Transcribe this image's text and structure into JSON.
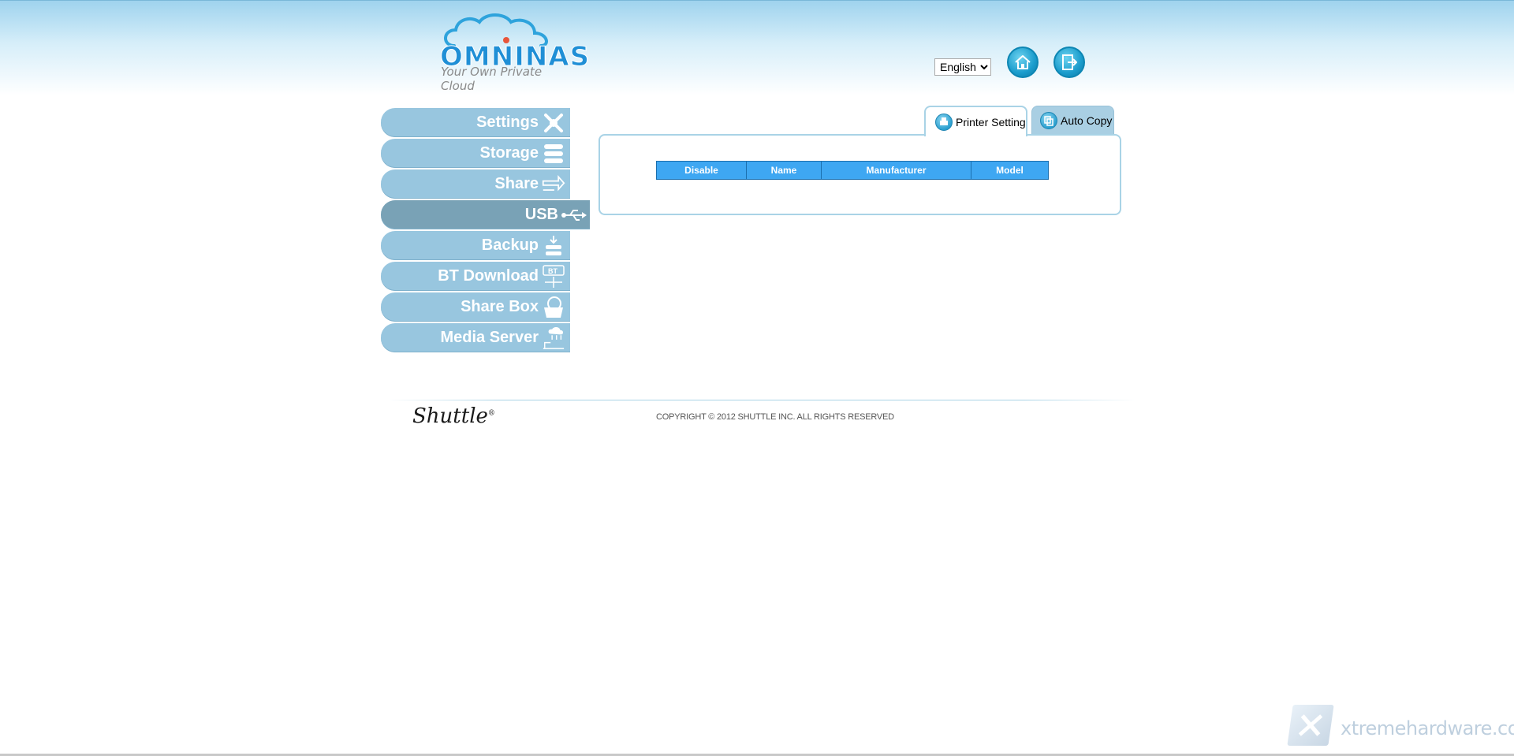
{
  "header": {
    "logo_text": "OMNINAS",
    "logo_tagline": "Your Own Private Cloud",
    "language": {
      "selected": "English",
      "options": [
        "English"
      ]
    },
    "home_icon": "home-icon",
    "logout_icon": "logout-icon"
  },
  "sidebar": {
    "items": [
      {
        "label": "Settings",
        "icon": "tools-icon",
        "active": false
      },
      {
        "label": "Storage",
        "icon": "storage-icon",
        "active": false
      },
      {
        "label": "Share",
        "icon": "share-arrow-icon",
        "active": false
      },
      {
        "label": "USB",
        "icon": "usb-icon",
        "active": true
      },
      {
        "label": "Backup",
        "icon": "backup-icon",
        "active": false
      },
      {
        "label": "BT Download",
        "icon": "bt-download-icon",
        "active": false
      },
      {
        "label": "Share Box",
        "icon": "share-box-icon",
        "active": false
      },
      {
        "label": "Media Server",
        "icon": "media-server-icon",
        "active": false
      }
    ]
  },
  "tabs": [
    {
      "label": "Printer Setting",
      "icon": "printer-icon",
      "active": true
    },
    {
      "label": "Auto Copy",
      "icon": "auto-copy-icon",
      "active": false
    }
  ],
  "printer_table": {
    "columns": [
      "Disable",
      "Name",
      "Manufacturer",
      "Model"
    ],
    "rows": []
  },
  "footer": {
    "brand": "Shuttle",
    "copyright": "COPYRIGHT © 2012 SHUTTLE INC. ALL RIGHTS RESERVED"
  },
  "watermark": "xtremehardware.com",
  "colors": {
    "sidebar_item": "#98c6df",
    "sidebar_active": "#79a2b6",
    "table_header": "#3ea7f2",
    "panel_border": "#a9d3e6"
  }
}
